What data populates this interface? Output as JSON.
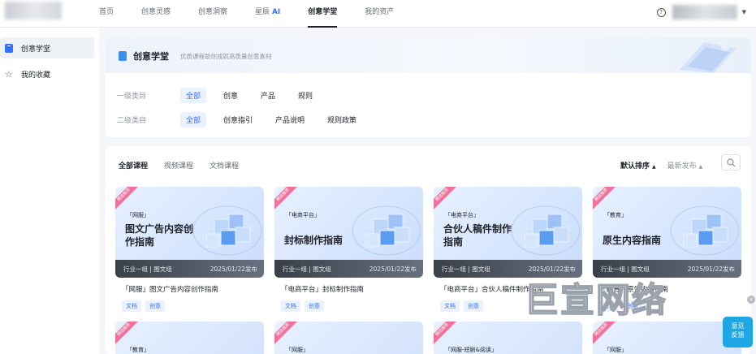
{
  "nav": {
    "items": [
      {
        "label": "首页",
        "active": false
      },
      {
        "label": "创意灵感",
        "active": false
      },
      {
        "label": "创意洞察",
        "active": false
      },
      {
        "label": "星辰",
        "suffix": "AI",
        "active": false
      },
      {
        "label": "创意学堂",
        "active": true
      },
      {
        "label": "我的资产",
        "active": false
      }
    ]
  },
  "sidebar": {
    "items": [
      {
        "label": "创意学堂",
        "icon": "book-icon",
        "active": true
      },
      {
        "label": "我的收藏",
        "icon": "star-icon",
        "active": false
      }
    ]
  },
  "header": {
    "title": "创意学堂",
    "subtitle": "优质课程助你成就高质量创意素材"
  },
  "filters": {
    "level1": {
      "label": "一级类目",
      "options": [
        "全部",
        "创意",
        "产品",
        "规则"
      ],
      "selected": "全部"
    },
    "level2": {
      "label": "二级类目",
      "options": [
        "全部",
        "创意指引",
        "产品说明",
        "规则政策"
      ],
      "selected": "全部"
    }
  },
  "tabs": [
    {
      "label": "全部课程",
      "active": true
    },
    {
      "label": "视频课程",
      "active": false
    },
    {
      "label": "文档课程",
      "active": false
    }
  ],
  "sorts": [
    {
      "label": "默认排序",
      "active": true
    },
    {
      "label": "最新发布",
      "active": false
    }
  ],
  "cards": [
    {
      "ribbon": "精选推荐",
      "category": "「网服」",
      "thumb_title": "图文广告内容创作指南",
      "footer_left": "行业一组 | 图文组",
      "footer_right": "2025/01/22发布",
      "title": "「网服」图文广告内容创作指南",
      "tags": [
        "文档",
        "创意"
      ]
    },
    {
      "ribbon": "精选推荐",
      "category": "「电商平台」",
      "thumb_title": "封标制作指南",
      "footer_left": "行业一组 | 图文组",
      "footer_right": "2025/01/22发布",
      "title": "「电商平台」封标制作指南",
      "tags": [
        "文档",
        "创意"
      ]
    },
    {
      "ribbon": "精选推荐",
      "category": "「电商平台」",
      "thumb_title": "合伙人稿件制作指南",
      "footer_left": "行业一组 | 图文组",
      "footer_right": "2025/01/22发布",
      "title": "「电商平台」合伙人稿件制作指南",
      "tags": [
        "文档",
        "创意"
      ]
    },
    {
      "ribbon": "精选推荐",
      "category": "「教育」",
      "thumb_title": "原生内容指南",
      "footer_left": "行业一组 | 图文组",
      "footer_right": "2025/01/22发布",
      "title": "「教育」原生内容指南",
      "tags": [
        "文档",
        "创意"
      ]
    }
  ],
  "cards_row2": [
    {
      "ribbon": "精选推荐",
      "category": "「教育」"
    },
    {
      "ribbon": "精选推荐",
      "category": "「网服」"
    },
    {
      "ribbon": "精选推荐",
      "category": "「网服-短剧&阅读」"
    },
    {
      "ribbon": "精选推荐",
      "category": "「网服」"
    }
  ],
  "watermark": "巨宣网络",
  "feedback": {
    "line1": "意见",
    "line2": "反馈"
  },
  "colors": {
    "accent": "#3370ff",
    "feedback": "#1ea7e4",
    "ribbon": "#f2709a"
  }
}
